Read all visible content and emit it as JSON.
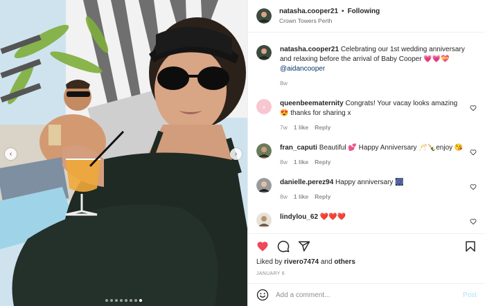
{
  "post": {
    "author": "natasha.cooper21",
    "separator": "•",
    "follow_label": "Following",
    "location": "Crown Towers Perth",
    "image_alt": "Selfie of a pregnant woman in a black swimsuit and visor lounging by a pool with a man in the background",
    "carousel": {
      "slides": 8,
      "active": 7
    }
  },
  "caption": {
    "username": "natasha.cooper21",
    "text": "Celebrating our 1st wedding anniversary and relaxing before the arrival of Baby Cooper 💗💗💝",
    "mention": "@aidancooper",
    "age": "8w"
  },
  "comments": [
    {
      "username": "queenbeematernity",
      "text": "Congrats! Your vacay looks amazing 😍 thanks for sharing x",
      "age": "7w",
      "likes": "1 like",
      "reply": "Reply"
    },
    {
      "username": "fran_caputi",
      "text": "Beautiful 💕 Happy Anniversary 🥂🍾enjoy 😘",
      "age": "8w",
      "likes": "1 like",
      "reply": "Reply"
    },
    {
      "username": "danielle.perez94",
      "text": "Happy anniversary 🎆",
      "age": "8w",
      "likes": "1 like",
      "reply": "Reply"
    },
    {
      "username": "lindylou_62",
      "text": "❤️❤️❤️",
      "age": "",
      "likes": "",
      "reply": ""
    }
  ],
  "likes": {
    "prefix": "Liked by ",
    "user": "rivero7474",
    "joiner": " and ",
    "others": "others"
  },
  "date": "JANUARY 6",
  "add_comment": {
    "placeholder": "Add a comment...",
    "post_label": "Post"
  },
  "icons": {
    "like": "heart-filled-icon",
    "comment": "comment-bubble-icon",
    "share": "paper-plane-icon",
    "save": "bookmark-icon",
    "emoji": "smiley-icon",
    "carousel_prev": "chevron-left-icon",
    "carousel_next": "chevron-right-icon"
  },
  "colors": {
    "like_red": "#ed4956",
    "link_blue": "#00376b",
    "post_disabled": "#b2dffc",
    "meta_gray": "#8e8e8e"
  }
}
